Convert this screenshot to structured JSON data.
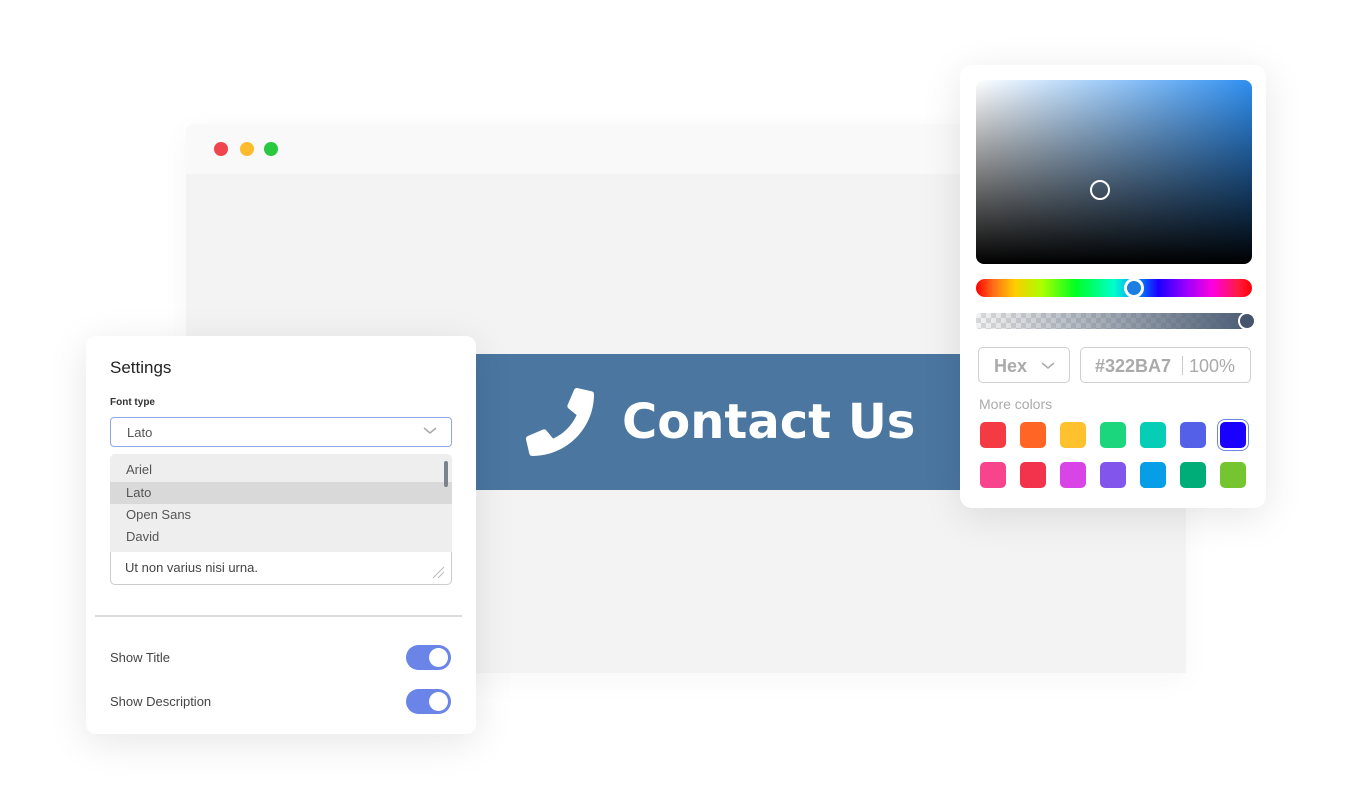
{
  "browser": {
    "window_controls": [
      {
        "name": "close",
        "color": "#f0444f"
      },
      {
        "name": "minimize",
        "color": "#fdbb2d"
      },
      {
        "name": "maximize",
        "color": "#28c840"
      }
    ]
  },
  "banner": {
    "icon": "phone-icon",
    "label": "Contact Us",
    "background": "#4a76a0"
  },
  "settings": {
    "title": "Settings",
    "font_type_label": "Font type",
    "font_select_value": "Lato",
    "font_options": [
      "Ariel",
      "Lato",
      "Open Sans",
      "David"
    ],
    "font_selected_index": 1,
    "description_value": "Ut non varius nisi urna.",
    "toggles": [
      {
        "label": "Show Title",
        "on": true
      },
      {
        "label": "Show Description",
        "on": true
      }
    ],
    "accent": "#6a84e8"
  },
  "color_picker": {
    "format": "Hex",
    "hex_value": "#322BA7",
    "opacity": "100%",
    "more_colors_label": "More colors",
    "swatches": [
      [
        "#f43b44",
        "#ff6525",
        "#ffc12e",
        "#1bd67c",
        "#06cdb5",
        "#5460e8",
        "#1a00ff"
      ],
      [
        "#f7448d",
        "#f3334b",
        "#d944e6",
        "#8256ec",
        "#069ee6",
        "#00ad78",
        "#74c52f"
      ]
    ],
    "selected_swatch": [
      0,
      6
    ]
  }
}
